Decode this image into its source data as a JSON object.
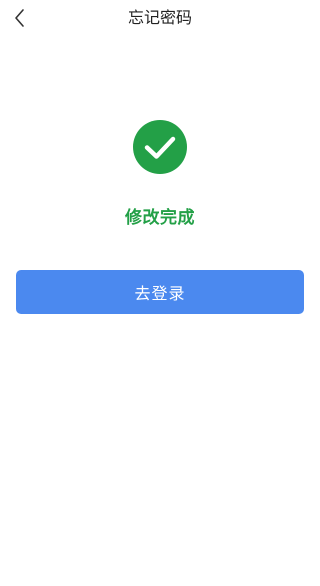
{
  "header": {
    "title": "忘记密码",
    "back_icon": "chevron-left-icon"
  },
  "result": {
    "icon": "check-circle-icon",
    "message": "修改完成"
  },
  "actions": {
    "login_label": "去登录"
  },
  "colors": {
    "success": "#23a047",
    "primary": "#4b89ef",
    "title_text": "#222222",
    "background": "#ffffff"
  }
}
